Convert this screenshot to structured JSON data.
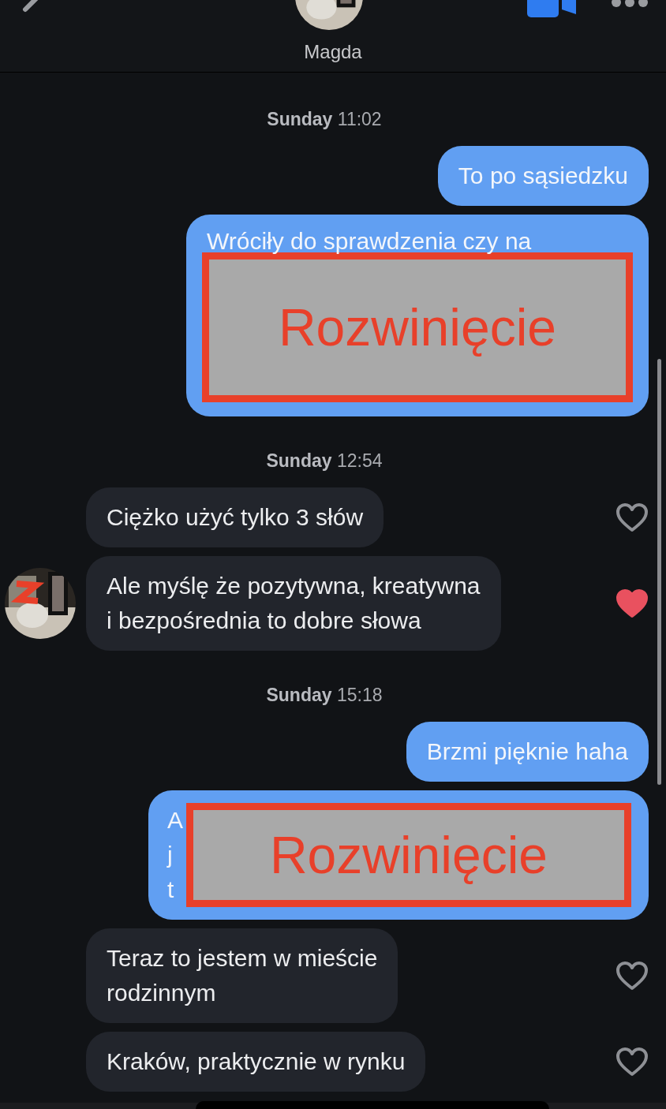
{
  "header": {
    "contact_name": "Magda"
  },
  "messages": [
    {
      "kind": "timestamp",
      "day": "Sunday",
      "time": "11:02"
    },
    {
      "kind": "sent",
      "lines": [
        "To po sąsiedzku"
      ]
    },
    {
      "kind": "sent",
      "lines": [
        "Wróciły do sprawdzenia czy na"
      ],
      "overlay": "Rozwinięcie"
    },
    {
      "kind": "timestamp",
      "day": "Sunday",
      "time": "12:54"
    },
    {
      "kind": "received",
      "lines": [
        "Ciężko użyć tylko 3 słów"
      ],
      "liked": false
    },
    {
      "kind": "received",
      "lines": [
        "Ale myślę że pozytywna, kreatywna",
        "i bezpośrednia to dobre słowa"
      ],
      "liked": true,
      "avatar": true
    },
    {
      "kind": "timestamp",
      "day": "Sunday",
      "time": "15:18"
    },
    {
      "kind": "sent",
      "lines": [
        "Brzmi pięknie haha"
      ]
    },
    {
      "kind": "sent",
      "lines": [
        "A",
        "j",
        "t"
      ],
      "overlay": "Rozwinięcie"
    },
    {
      "kind": "received",
      "lines": [
        "Teraz to jestem w mieście",
        "rodzinnym"
      ],
      "liked": false
    },
    {
      "kind": "received",
      "lines": [
        "Kraków, praktycznie w rynku"
      ],
      "liked": false
    }
  ]
}
